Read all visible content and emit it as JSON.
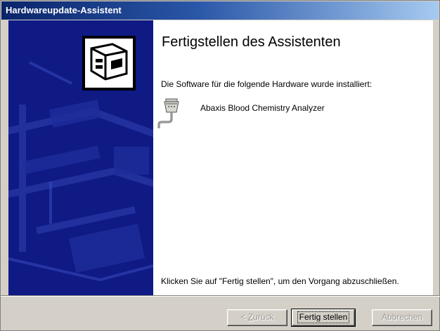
{
  "window": {
    "title": "Hardwareupdate-Assistent"
  },
  "content": {
    "heading": "Fertigstellen des Assistenten",
    "description": "Die Software für die folgende Hardware wurde installiert:",
    "device": {
      "icon": "serial-port-icon",
      "name": "Abaxis Blood Chemistry Analyzer"
    },
    "finish_hint": "Klicken Sie auf \"Fertig stellen\", um den Vorgang abzuschließen."
  },
  "buttons": {
    "back": {
      "prefix": "< ",
      "accel": "Z",
      "rest": "urück",
      "enabled": false
    },
    "finish": {
      "label": "Fertig stellen",
      "enabled": true,
      "default": true
    },
    "cancel": {
      "label": "Abbrechen",
      "enabled": false
    }
  },
  "colors": {
    "title_gradient_start": "#0a246a",
    "title_gradient_end": "#a6caf0",
    "banner": "#0f1a84",
    "window_bg": "#d4d0c8"
  }
}
